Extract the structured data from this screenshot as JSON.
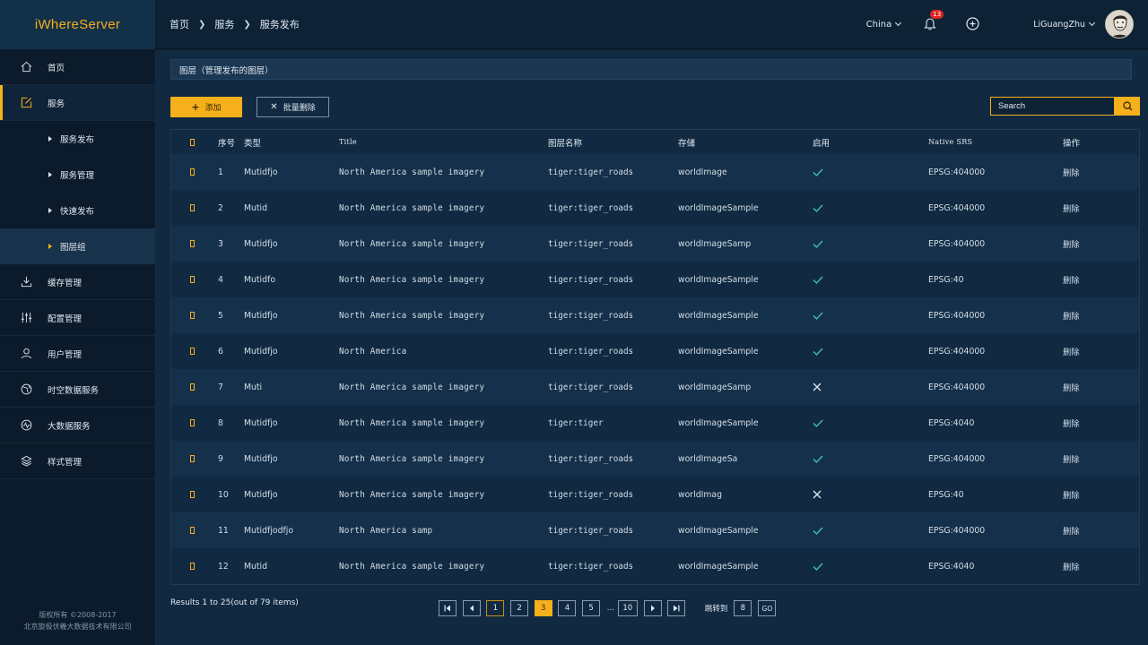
{
  "app": {
    "title": "iWhereServer"
  },
  "header": {
    "breadcrumb": [
      "首页",
      "服务",
      "服务发布"
    ],
    "region": "China",
    "notification_count": "13",
    "user_name": "LiGuangZhu"
  },
  "sidebar": {
    "items": [
      {
        "label": "首页",
        "icon": "home-icon"
      },
      {
        "label": "服务",
        "icon": "edit-icon"
      },
      {
        "label": "缓存管理",
        "icon": "download-icon"
      },
      {
        "label": "配置管理",
        "icon": "sliders-icon"
      },
      {
        "label": "用户管理",
        "icon": "user-icon"
      },
      {
        "label": "时空数据服务",
        "icon": "globe-icon"
      },
      {
        "label": "大数据服务",
        "icon": "pulse-icon"
      },
      {
        "label": "样式管理",
        "icon": "layers-icon"
      }
    ],
    "sub_items": [
      "服务发布",
      "服务管理",
      "快速发布",
      "图层组"
    ],
    "copyright_line1": "版权所有 ©2008-2017",
    "copyright_line2": "北京旋极伏羲大数据技术有限公司"
  },
  "main": {
    "section_title": "图层（管理发布的图层）",
    "add_label": "添加",
    "batch_delete_label": "批量删除",
    "search_placeholder": "Search"
  },
  "table": {
    "headers": [
      "序号",
      "类型",
      "Title",
      "图层名称",
      "存储",
      "启用",
      "Native SRS",
      "操作"
    ],
    "rows": [
      {
        "no": "1",
        "type": "Mutidfjo",
        "title": "North America sample imagery",
        "layer": "tiger:tiger_roads",
        "store": "worldImage",
        "enabled": true,
        "srs": "EPSG:404000",
        "action": "删除"
      },
      {
        "no": "2",
        "type": "Mutid",
        "title": "North America sample imagery",
        "layer": "tiger:tiger_roads",
        "store": "worldImageSample",
        "enabled": true,
        "srs": "EPSG:404000",
        "action": "删除"
      },
      {
        "no": "3",
        "type": "Mutidfjo",
        "title": "North America sample imagery",
        "layer": "tiger:tiger_roads",
        "store": "worldImageSamp",
        "enabled": true,
        "srs": "EPSG:404000",
        "action": "删除"
      },
      {
        "no": "4",
        "type": "Mutidfo",
        "title": "North America sample imagery",
        "layer": "tiger:tiger_roads",
        "store": "worldImageSample",
        "enabled": true,
        "srs": "EPSG:40",
        "action": "删除"
      },
      {
        "no": "5",
        "type": "Mutidfjo",
        "title": "North America sample imagery",
        "layer": "tiger:tiger_roads",
        "store": "worldImageSample",
        "enabled": true,
        "srs": "EPSG:404000",
        "action": "删除"
      },
      {
        "no": "6",
        "type": "Mutidfjo",
        "title": "North America",
        "layer": "tiger:tiger_roads",
        "store": "worldImageSample",
        "enabled": true,
        "srs": "EPSG:404000",
        "action": "删除"
      },
      {
        "no": "7",
        "type": "Muti",
        "title": "North America sample imagery",
        "layer": "tiger:tiger_roads",
        "store": "worldImageSamp",
        "enabled": false,
        "srs": "EPSG:404000",
        "action": "删除"
      },
      {
        "no": "8",
        "type": "Mutidfjo",
        "title": "North America sample imagery",
        "layer": "tiger:tiger",
        "store": "worldImageSample",
        "enabled": true,
        "srs": "EPSG:4040",
        "action": "删除"
      },
      {
        "no": "9",
        "type": "Mutidfjo",
        "title": "North America sample imagery",
        "layer": "tiger:tiger_roads",
        "store": "worldImageSa",
        "enabled": true,
        "srs": "EPSG:404000",
        "action": "删除"
      },
      {
        "no": "10",
        "type": "Mutidfjo",
        "title": "North America sample imagery",
        "layer": "tiger:tiger_roads",
        "store": "worldImag",
        "enabled": false,
        "srs": "EPSG:40",
        "action": "删除"
      },
      {
        "no": "11",
        "type": "Mutidfjodfjo",
        "title": "North America samp",
        "layer": "tiger:tiger_roads",
        "store": "worldImageSample",
        "enabled": true,
        "srs": "EPSG:404000",
        "action": "删除"
      },
      {
        "no": "12",
        "type": "Mutid",
        "title": "North America sample imagery",
        "layer": "tiger:tiger_roads",
        "store": "worldImageSample",
        "enabled": true,
        "srs": "EPSG:4040",
        "action": "删除"
      }
    ]
  },
  "pagination": {
    "results_text": "Results 1 to 25(out of 79 items)",
    "pages": [
      "1",
      "2",
      "3",
      "4",
      "5",
      "...",
      "10"
    ],
    "current_page": "3",
    "goto_label": "跳转到",
    "goto_value": "8",
    "go_label": "GO"
  },
  "colors": {
    "accent": "#f5b01c",
    "check": "#3ec9b0",
    "background": "#112a42",
    "sidebar": "#0c1b2b"
  }
}
